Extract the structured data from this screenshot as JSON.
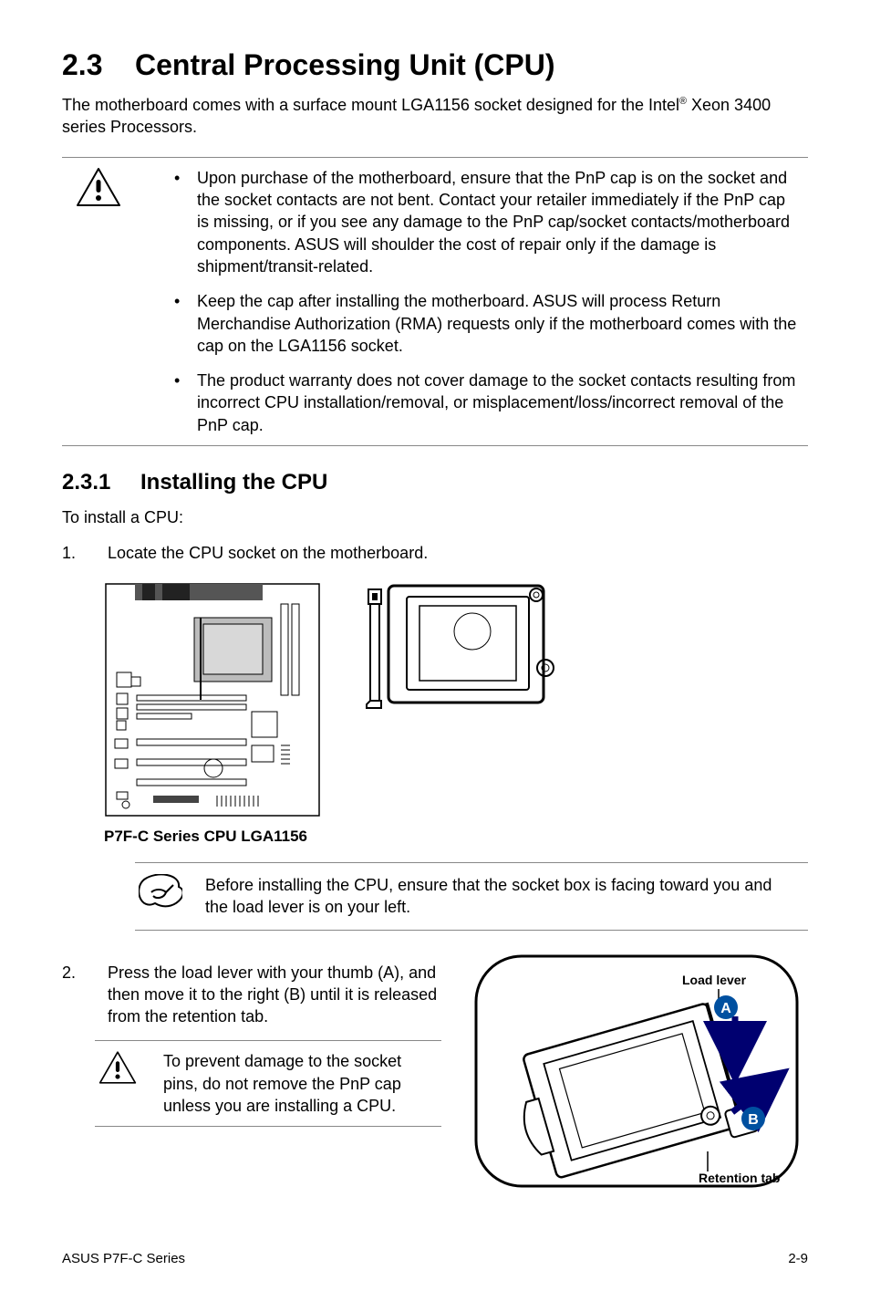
{
  "heading": {
    "number": "2.3",
    "title": "Central Processing Unit (CPU)"
  },
  "intro_part1": "The motherboard comes with a surface mount LGA1156 socket designed for the Intel",
  "intro_sup": "®",
  "intro_part2": " Xeon 3400 series Processors.",
  "caution_items": [
    "Upon purchase of the motherboard, ensure that the PnP cap is on the socket and the socket contacts are not bent. Contact your retailer immediately if the PnP cap is missing, or if you see any damage to the PnP cap/socket contacts/motherboard components. ASUS will shoulder the cost of repair only if the damage is shipment/transit-related.",
    "Keep the cap after installing the motherboard. ASUS will process Return Merchandise Authorization (RMA) requests only if the motherboard comes with the cap on the LGA1156 socket.",
    "The product warranty does not cover damage to the socket contacts resulting from incorrect CPU installation/removal, or misplacement/loss/incorrect removal of the PnP cap."
  ],
  "subheading": {
    "number": "2.3.1",
    "title": "Installing the CPU"
  },
  "sub_intro": "To install a CPU:",
  "steps": {
    "1": {
      "num": "1.",
      "text": "Locate the CPU socket on the motherboard."
    },
    "2": {
      "num": "2.",
      "text": "Press the load lever with your thumb (A), and then move it to the right (B) until it is released from the retention tab."
    }
  },
  "diagram_caption": "P7F-C Series CPU LGA1156",
  "note_text": "Before installing the CPU, ensure that the socket box is facing toward you and the load lever is on your left.",
  "inline_caution": "To prevent damage to the socket pins, do not remove the PnP cap unless you are installing a CPU.",
  "lever_labels": {
    "load_lever": "Load lever",
    "a": "A",
    "b": "B",
    "retention": "Retention tab"
  },
  "footer": {
    "left": "ASUS P7F-C Series",
    "right": "2-9"
  }
}
